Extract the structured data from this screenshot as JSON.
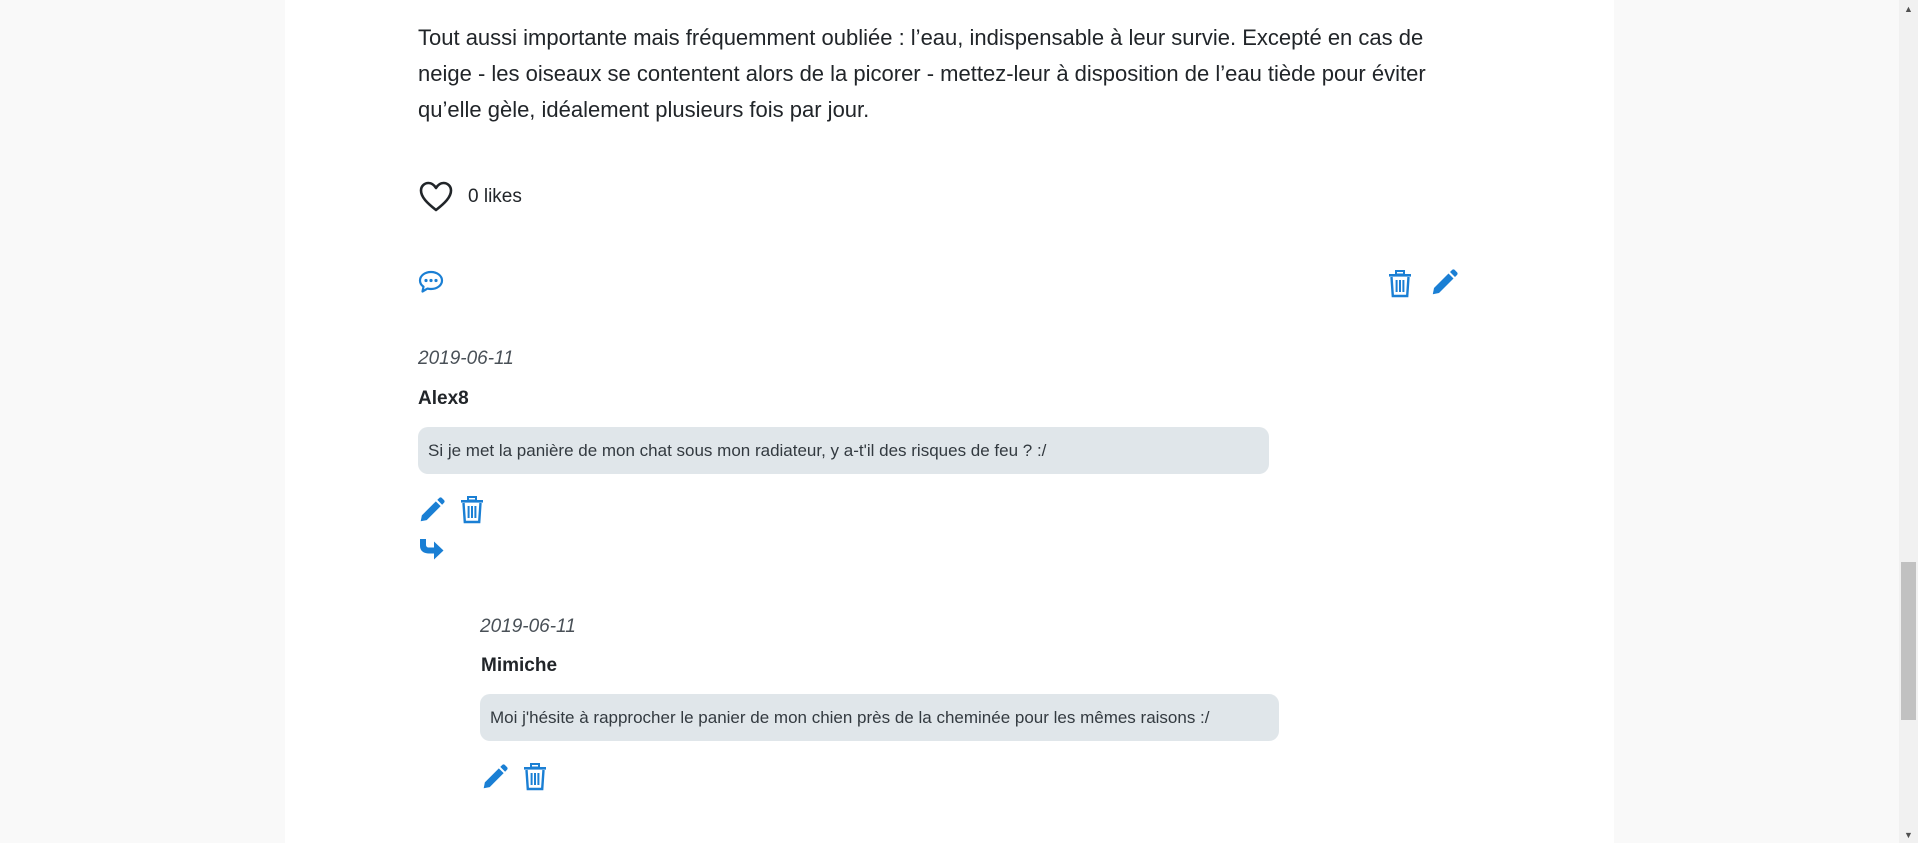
{
  "article": {
    "paragraph": "Tout aussi importante mais fréquemment oubliée : l’eau, indispensable à leur survie. Excepté en cas de neige - les oiseaux se contentent alors de la picorer - mettez-leur à disposition de l’eau tiède pour éviter qu’elle gèle, idéalement plusieurs fois par jour."
  },
  "likes": {
    "label": "0 likes",
    "count": 0,
    "icon": "heart-outline-icon"
  },
  "post_actions": {
    "comment_icon": "comment-dots-icon",
    "delete_icon": "trash-icon",
    "edit_icon": "pencil-icon"
  },
  "comments": [
    {
      "date": "2019-06-11",
      "author": "Alex8",
      "text": "Si je met la panière de mon chat sous mon radiateur, y a-t'il des risques de feu ? :/",
      "actions": [
        "edit",
        "delete",
        "reply"
      ]
    },
    {
      "date": "2019-06-11",
      "author": "Mimiche",
      "text": "Moi j'hésite à rapprocher le panier de mon chien près de la cheminée pour les mêmes raisons :/",
      "actions": [
        "edit",
        "delete"
      ],
      "is_reply": true
    }
  ],
  "colors": {
    "accent": "#1a7fd4",
    "bubble": "#e0e6ea",
    "page_bg": "#f9f9f9",
    "panel_bg": "#ffffff"
  }
}
